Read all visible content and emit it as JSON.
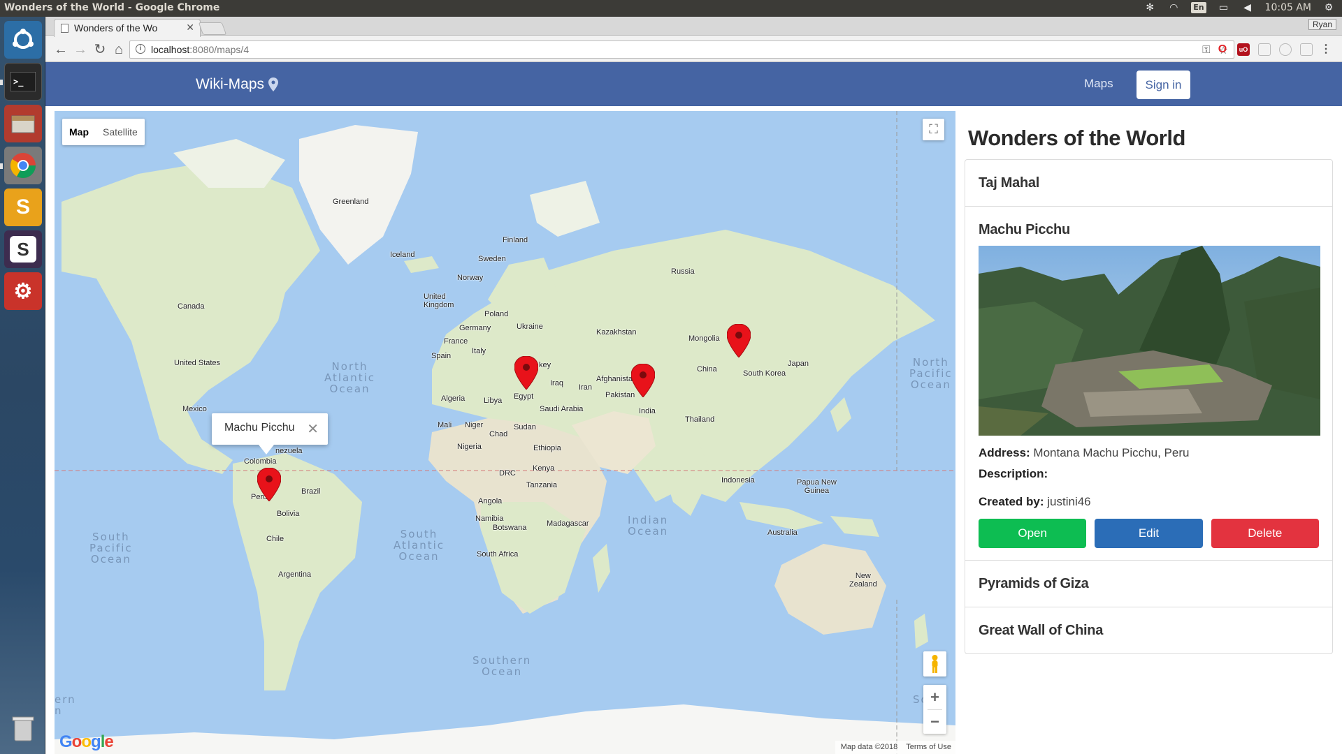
{
  "os": {
    "window_title": "Wonders of the World - Google Chrome",
    "lang": "En",
    "clock": "10:05 AM"
  },
  "browser": {
    "tab_title": "Wonders of the Wo",
    "profile": "Ryan",
    "url_host": "localhost",
    "url_path": ":8080/maps/4"
  },
  "navbar": {
    "brand": "Wiki-Maps",
    "maps_link": "Maps",
    "signin": "Sign in",
    "bg_color": "#4564a3"
  },
  "map": {
    "type_map": "Map",
    "type_satellite": "Satellite",
    "attribution": "Map data ©2018",
    "terms": "Terms of Use",
    "logo": "Google",
    "infowindow_title": "Machu Picchu",
    "oceans": {
      "north_atlantic": "North\nAtlantic\nOcean",
      "south_atlantic": "South\nAtlantic\nOcean",
      "south_pacific": "South\nPacific\nOcean",
      "north_pacific": "North\nPacific\nOcean",
      "indian": "Indian\nOcean",
      "southern": "Southern\nOcean",
      "left_cut": "ern\nn",
      "right_cut": "So"
    },
    "countries": {
      "greenland": "Greenland",
      "iceland": "Iceland",
      "finland": "Finland",
      "sweden": "Sweden",
      "norway": "Norway",
      "russia": "Russia",
      "uk": "United\nKingdom",
      "poland": "Poland",
      "germany": "Germany",
      "ukraine": "Ukraine",
      "france": "France",
      "italy": "Italy",
      "spain": "Spain",
      "kazakhstan": "Kazakhstan",
      "mongolia": "Mongolia",
      "china": "China",
      "south_korea": "South Korea",
      "japan": "Japan",
      "turkey": "key",
      "iraq": "Iraq",
      "iran": "Iran",
      "afghanistan": "Afghanista",
      "pakistan": "Pakistan",
      "india": "India",
      "thailand": "Thailand",
      "indonesia": "Indonesia",
      "png": "Papua New\nGuinea",
      "australia": "Australia",
      "nz": "New\nZealand",
      "canada": "Canada",
      "usa": "United States",
      "mexico": "Mexico",
      "venezuela": "nezuela",
      "colombia": "Colombia",
      "peru": "Peru",
      "brazil": "Brazil",
      "bolivia": "Bolivia",
      "chile": "Chile",
      "argentina": "Argentina",
      "algeria": "Algeria",
      "libya": "Libya",
      "egypt": "Egypt",
      "saudi": "Saudi Arabia",
      "mali": "Mali",
      "niger": "Niger",
      "chad": "Chad",
      "sudan": "Sudan",
      "nigeria": "Nigeria",
      "ethiopia": "Ethiopia",
      "drc": "DRC",
      "kenya": "Kenya",
      "tanzania": "Tanzania",
      "angola": "Angola",
      "namibia": "Namibia",
      "botswana": "Botswana",
      "madagascar": "Madagascar",
      "south_africa": "South Africa"
    },
    "water_color": "#a6cbf0",
    "land_color": "#dde9c9",
    "marker_color": "#e8121a"
  },
  "panel": {
    "title": "Wonders of the World",
    "places": [
      {
        "name": "Taj Mahal"
      },
      {
        "name": "Machu Picchu"
      },
      {
        "name": "Pyramids of Giza"
      },
      {
        "name": "Great Wall of China"
      }
    ],
    "selected": {
      "address_label": "Address:",
      "address": "Montana Machu Picchu, Peru",
      "description_label": "Description:",
      "created_label": "Created by:",
      "created_by": "justini46"
    },
    "buttons": {
      "open": "Open",
      "edit": "Edit",
      "delete": "Delete",
      "open_color": "#0dbd52",
      "edit_color": "#2b6db7",
      "delete_color": "#e3333f"
    }
  }
}
